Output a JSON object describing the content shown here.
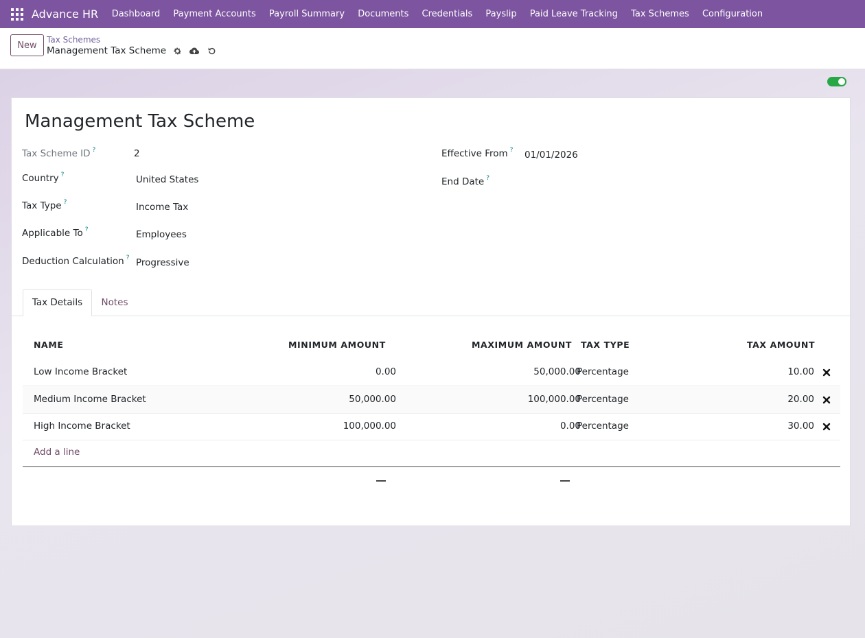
{
  "navbar": {
    "brand": "Advance HR",
    "items": [
      "Dashboard",
      "Payment Accounts",
      "Payroll Summary",
      "Documents",
      "Credentials",
      "Payslip",
      "Paid Leave Tracking",
      "Tax Schemes",
      "Configuration"
    ],
    "accent_color": "#7c549f"
  },
  "control_panel": {
    "new_label": "New",
    "breadcrumb": "Tax Schemes",
    "record_title": "Management Tax Scheme",
    "icons": [
      "gear-icon",
      "cloud-upload-icon",
      "undo-icon"
    ]
  },
  "record": {
    "title": "Management Tax Scheme",
    "active": true,
    "fields_left": [
      {
        "label": "Tax Scheme ID",
        "value": "2"
      },
      {
        "label": "Country",
        "value": "United States"
      },
      {
        "label": "Tax Type",
        "value": "Income Tax"
      },
      {
        "label": "Applicable To",
        "value": "Employees"
      },
      {
        "label": "Deduction Calculation",
        "value": "Progressive"
      }
    ],
    "fields_right": [
      {
        "label": "Effective From",
        "value": "01/01/2026"
      },
      {
        "label": "End Date",
        "value": ""
      }
    ],
    "help_mark": "?"
  },
  "tabs": [
    {
      "label": "Tax Details",
      "active": true
    },
    {
      "label": "Notes",
      "active": false
    }
  ],
  "table": {
    "columns": [
      "NAME",
      "MINIMUM AMOUNT",
      "MAXIMUM AMOUNT",
      "TAX TYPE",
      "TAX AMOUNT"
    ],
    "rows": [
      {
        "name": "Low Income Bracket",
        "min": "0.00",
        "max": "50,000.00",
        "type": "Percentage",
        "amount": "10.00"
      },
      {
        "name": "Medium Income Bracket",
        "min": "50,000.00",
        "max": "100,000.00",
        "type": "Percentage",
        "amount": "20.00"
      },
      {
        "name": "High Income Bracket",
        "min": "100,000.00",
        "max": "0.00",
        "type": "Percentage",
        "amount": "30.00"
      }
    ],
    "add_line": "Add a line"
  }
}
